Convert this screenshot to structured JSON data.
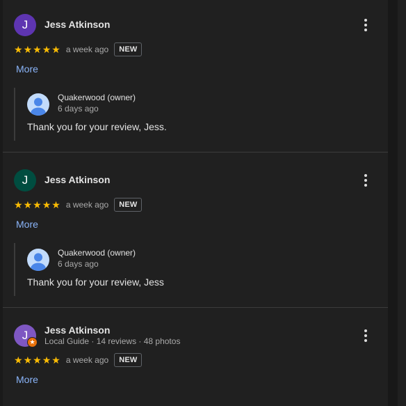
{
  "reviews": [
    {
      "author": "Jess Atkinson",
      "avatar_initial": "J",
      "avatar_color": "#5e35b1",
      "local_guide": false,
      "rating": 5,
      "date": "a week ago",
      "new_label": "NEW",
      "more_label": "More",
      "reply": {
        "owner": "Quakerwood (owner)",
        "date": "6 days ago",
        "text": "Thank you for your review, Jess."
      }
    },
    {
      "author": "Jess Atkinson",
      "avatar_initial": "J",
      "avatar_color": "#004d40",
      "local_guide": false,
      "rating": 5,
      "date": "a week ago",
      "new_label": "NEW",
      "more_label": "More",
      "reply": {
        "owner": "Quakerwood (owner)",
        "date": "6 days ago",
        "text": "Thank you for your review, Jess"
      }
    },
    {
      "author": "Jess Atkinson",
      "avatar_initial": "J",
      "avatar_color": "#7e57c2",
      "local_guide": true,
      "guide_info": "Local Guide · 14 reviews · 48 photos",
      "rating": 5,
      "date": "a week ago",
      "new_label": "NEW",
      "more_label": "More"
    }
  ],
  "colors": {
    "background": "#202020",
    "star": "#fbbc04",
    "link": "#8ab4f8",
    "guide_badge": "#e8710a"
  },
  "icons": {
    "star": "star-icon",
    "menu": "more-vert-icon",
    "owner_avatar": "default-profile-icon",
    "guide_badge": "local-guide-star-icon"
  }
}
